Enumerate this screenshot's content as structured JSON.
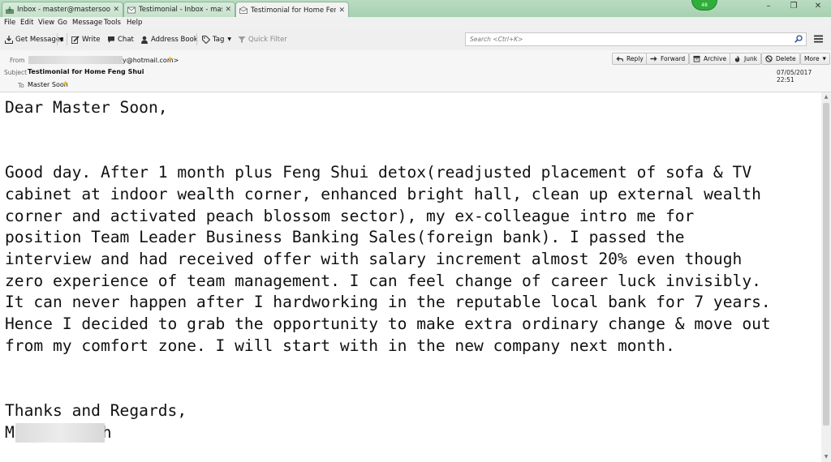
{
  "tabs": [
    {
      "label": "Inbox - master@mastersoon.c...",
      "icon": "inbox-download-icon",
      "close": "✕"
    },
    {
      "label": "Testimonial - Inbox - mas...",
      "icon": "envelope-icon",
      "close": "✕"
    },
    {
      "label": "Testimonial for Home Fen...",
      "icon": "envelope-open-icon",
      "close": "✕"
    }
  ],
  "badge": "48",
  "window_controls": {
    "minimize": "–",
    "restore": "❐",
    "close": "✕"
  },
  "menu": [
    "File",
    "Edit",
    "View",
    "Go",
    "Message",
    "Tools",
    "Help"
  ],
  "toolbar": {
    "get_messages": "Get Messages",
    "write": "Write",
    "chat": "Chat",
    "address_book": "Address Book",
    "tag": "Tag",
    "quick_filter": "Quick Filter",
    "search_placeholder": "Search <Ctrl+K>"
  },
  "header": {
    "from_label": "From",
    "from_value": "y@hotmail.com>",
    "subject_label": "Subject",
    "subject_value": "Testimonial for Home Feng Shui",
    "to_label": "To",
    "to_value": "Master Soon",
    "date": "07/05/2017 22:51",
    "actions": [
      "Reply",
      "Forward",
      "Archive",
      "Junk",
      "Delete",
      "More"
    ]
  },
  "body": {
    "greeting": "Dear Master Soon,",
    "paragraph_lines": [
      "Good day. After 1 month plus Feng Shui detox(readjusted placement of sofa & TV",
      "cabinet at indoor wealth corner, enhanced bright hall, clean up external wealth",
      "corner and activated peach blossom sector), my ex-colleague intro me for",
      "position Team Leader Business Banking Sales(foreign bank). I passed the",
      "interview and had received offer with salary increment almost 20% even though",
      "zero experience of team management. I can feel change of career luck invisibly.",
      "It can never happen after I hardworking in the reputable local bank for 7 years.",
      "Hence I decided to grab the opportunity to make extra ordinary change & move out",
      "from my comfort zone. I will start with in the new company next month."
    ],
    "closing": "Thanks and Regards,",
    "signature_first": "M",
    "signature_last": "h"
  },
  "colors": {
    "tab_strip": "#a6d0b0",
    "badge": "#2fae3a",
    "star": "#e8b923"
  }
}
